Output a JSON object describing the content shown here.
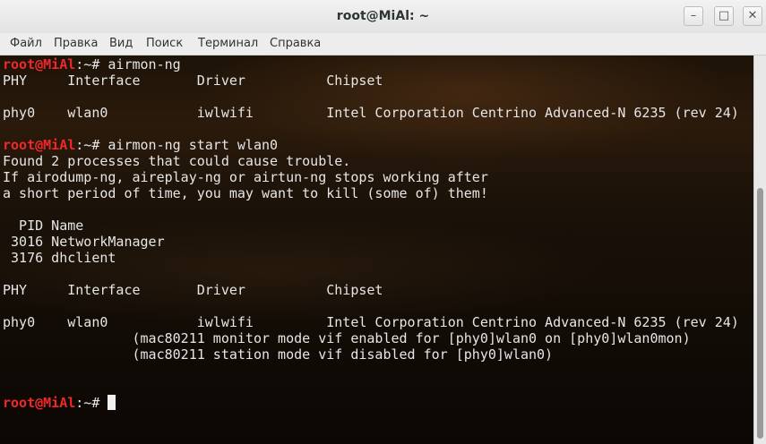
{
  "window": {
    "title": "root@MiAl: ~",
    "controls": {
      "minimize": "–",
      "maximize": "□",
      "close": "✕"
    }
  },
  "menu": [
    "Файл",
    "Правка",
    "Вид",
    "Поиск",
    "Терминал",
    "Справка"
  ],
  "terminal": {
    "lines": [
      {
        "user": "root@MiAl",
        "rest": ":~# airmon-ng"
      },
      {
        "text": "PHY     Interface       Driver          Chipset"
      },
      {
        "text": ""
      },
      {
        "text": "phy0    wlan0           iwlwifi         Intel Corporation Centrino Advanced-N 6235 (rev 24)"
      },
      {
        "text": ""
      },
      {
        "user": "root@MiAl",
        "rest": ":~# airmon-ng start wlan0"
      },
      {
        "text": "Found 2 processes that could cause trouble."
      },
      {
        "text": "If airodump-ng, aireplay-ng or airtun-ng stops working after"
      },
      {
        "text": "a short period of time, you may want to kill (some of) them!"
      },
      {
        "text": ""
      },
      {
        "text": "  PID Name"
      },
      {
        "text": " 3016 NetworkManager"
      },
      {
        "text": " 3176 dhclient"
      },
      {
        "text": ""
      },
      {
        "text": "PHY     Interface       Driver          Chipset"
      },
      {
        "text": ""
      },
      {
        "text": "phy0    wlan0           iwlwifi         Intel Corporation Centrino Advanced-N 6235 (rev 24)"
      },
      {
        "text": "                (mac80211 monitor mode vif enabled for [phy0]wlan0 on [phy0]wlan0mon)"
      },
      {
        "text": "                (mac80211 station mode vif disabled for [phy0]wlan0)"
      },
      {
        "text": ""
      },
      {
        "text": ""
      },
      {
        "user": "root@MiAl",
        "rest": ":~# ",
        "cursor": true
      }
    ]
  }
}
